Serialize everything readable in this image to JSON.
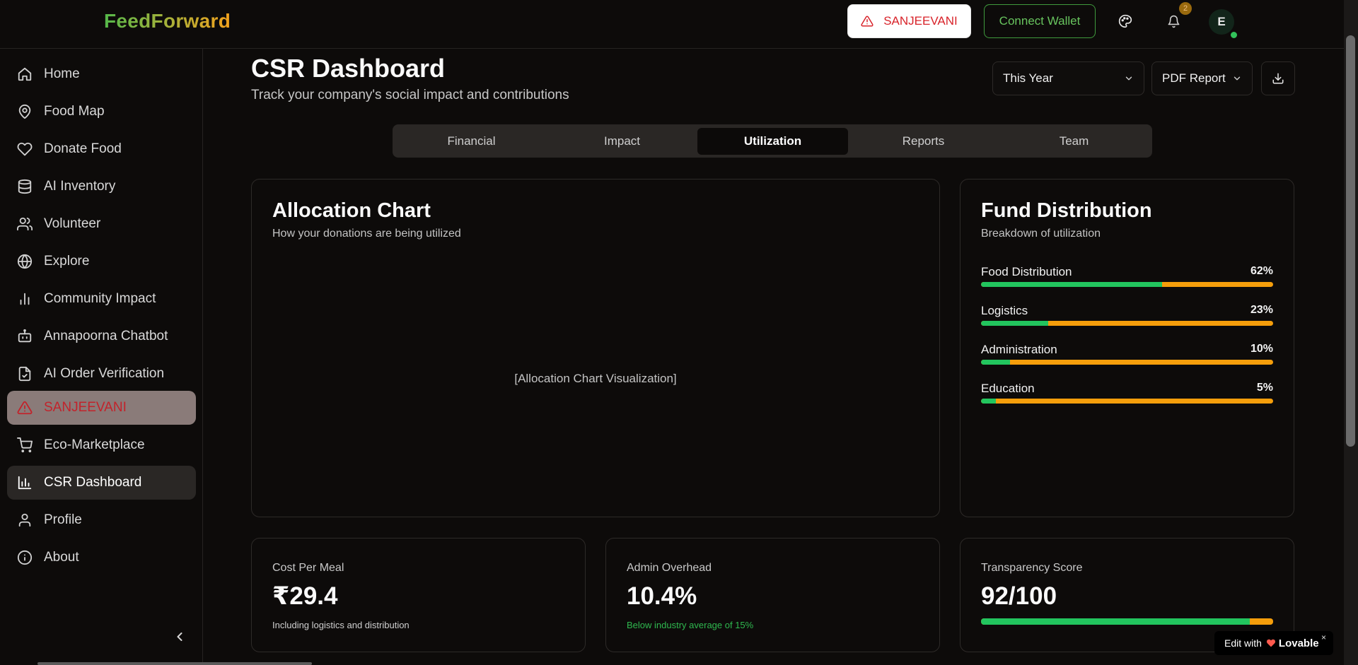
{
  "header": {
    "logo": "FeedForward",
    "sanjeevani_label": "SANJEEVANI",
    "wallet_label": "Connect Wallet",
    "notif_count": "2",
    "avatar_initial": "E"
  },
  "sidebar": {
    "items": [
      {
        "label": "Home",
        "icon": "home-icon"
      },
      {
        "label": "Food Map",
        "icon": "map-pin-icon"
      },
      {
        "label": "Donate Food",
        "icon": "heart-icon"
      },
      {
        "label": "AI Inventory",
        "icon": "database-icon"
      },
      {
        "label": "Volunteer",
        "icon": "users-icon"
      },
      {
        "label": "Explore",
        "icon": "globe-icon"
      },
      {
        "label": "Community Impact",
        "icon": "bar-chart-icon"
      },
      {
        "label": "Annapoorna Chatbot",
        "icon": "bot-icon"
      },
      {
        "label": "AI Order Verification",
        "icon": "file-check-icon"
      },
      {
        "label": "SANJEEVANI",
        "icon": "alert-triangle-icon"
      },
      {
        "label": "Eco-Marketplace",
        "icon": "cart-icon"
      },
      {
        "label": "CSR Dashboard",
        "icon": "chart-icon"
      },
      {
        "label": "Profile",
        "icon": "user-icon"
      },
      {
        "label": "About",
        "icon": "info-icon"
      }
    ]
  },
  "main": {
    "title": "CSR Dashboard",
    "subtitle": "Track your company's social impact and contributions",
    "period_select": "This Year",
    "report_select": "PDF Report",
    "tabs": [
      "Financial",
      "Impact",
      "Utilization",
      "Reports",
      "Team"
    ],
    "active_tab": "Utilization",
    "allocation": {
      "title": "Allocation Chart",
      "subtitle": "How your donations are being utilized",
      "placeholder": "[Allocation Chart Visualization]"
    },
    "fund": {
      "title": "Fund Distribution",
      "subtitle": "Breakdown of utilization",
      "rows": [
        {
          "name": "Food Distribution",
          "percent_label": "62%",
          "value": 62
        },
        {
          "name": "Logistics",
          "percent_label": "23%",
          "value": 23
        },
        {
          "name": "Administration",
          "percent_label": "10%",
          "value": 10
        },
        {
          "name": "Education",
          "percent_label": "5%",
          "value": 5
        }
      ]
    },
    "stats": [
      {
        "label": "Cost Per Meal",
        "value": "₹29.4",
        "note": "Including logistics and distribution"
      },
      {
        "label": "Admin Overhead",
        "value": "10.4%",
        "note": "Below industry average of 15%"
      },
      {
        "label": "Transparency Score",
        "value": "92/100",
        "score": 92
      }
    ]
  },
  "badge": {
    "prefix": "Edit with",
    "brand": "Lovable",
    "close": "×"
  },
  "colors": {
    "accent_green": "#22c55e",
    "accent_orange": "#f59e0b",
    "alert_red": "#d8232a",
    "background": "#0d0b0a"
  }
}
